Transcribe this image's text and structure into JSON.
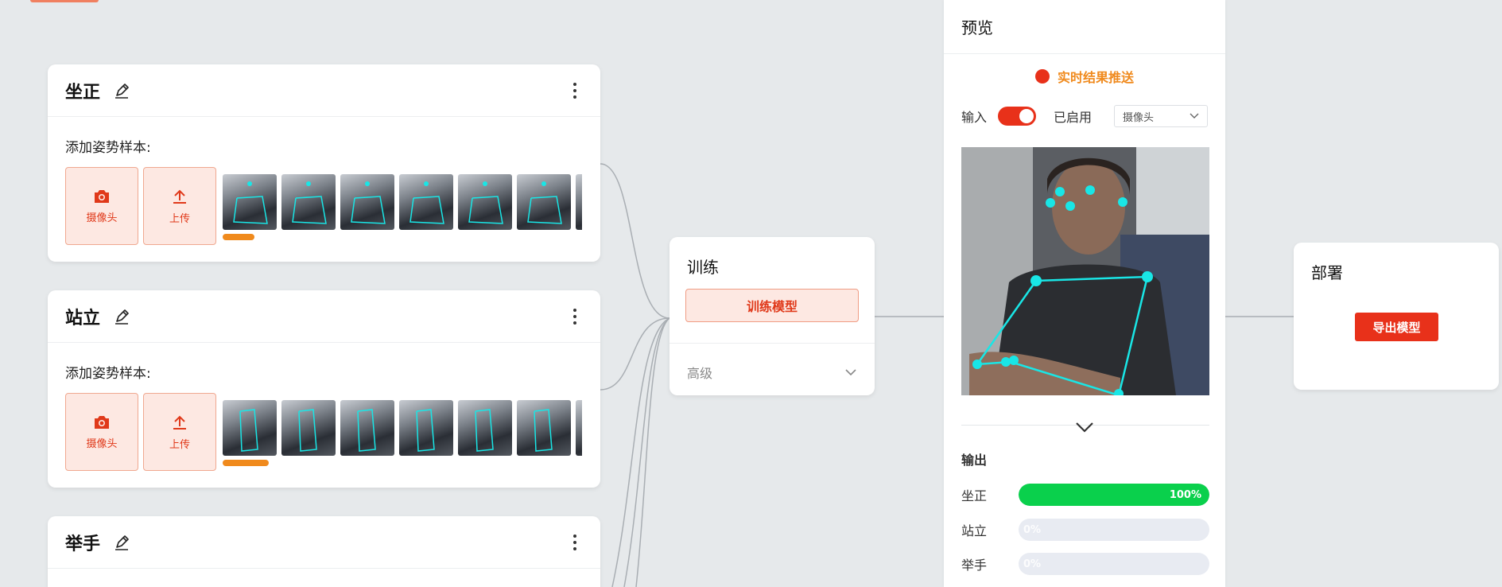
{
  "classes": [
    {
      "name": "坐正",
      "add_label": "添加姿势样本:",
      "camera_label": "摄像头",
      "upload_label": "上传"
    },
    {
      "name": "站立",
      "add_label": "添加姿势样本:",
      "camera_label": "摄像头",
      "upload_label": "上传"
    },
    {
      "name": "举手"
    }
  ],
  "train": {
    "title": "训练",
    "button_label": "训练模型",
    "advanced_label": "高级"
  },
  "preview": {
    "title": "预览",
    "live_label": "实时结果推送",
    "input_label": "输入",
    "enabled_label": "已启用",
    "source_select": "摄像头",
    "output_title": "输出",
    "outputs": [
      {
        "label": "坐正",
        "percent": 100,
        "percent_label": "100%"
      },
      {
        "label": "站立",
        "percent": 0,
        "percent_label": "0%"
      },
      {
        "label": "举手",
        "percent": 0,
        "percent_label": "0%"
      }
    ]
  },
  "deploy": {
    "title": "部署",
    "export_label": "导出模型"
  },
  "colors": {
    "accent": "#e8311a",
    "accent_soft": "#fde8e2",
    "progress": "#f08a1d",
    "confidence": "#0ad04c",
    "skeleton": "#19e6e6"
  },
  "icons": [
    "edit-icon",
    "more-vertical-icon",
    "camera-icon",
    "upload-icon",
    "chevron-down-icon"
  ]
}
